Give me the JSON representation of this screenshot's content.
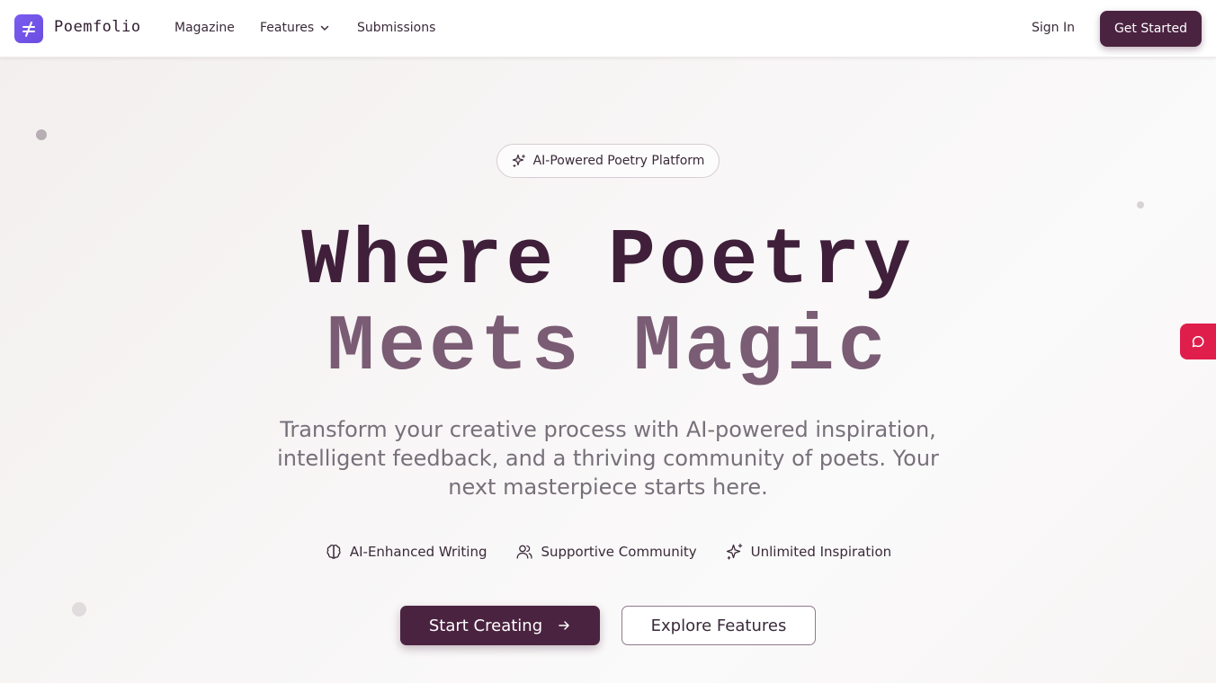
{
  "brand": {
    "name": "Poemfolio",
    "logo_icon": "not-equal-icon",
    "accent": "#6f52e8"
  },
  "nav": {
    "links": [
      {
        "label": "Magazine"
      },
      {
        "label": "Features",
        "has_dropdown": true
      },
      {
        "label": "Submissions"
      }
    ],
    "sign_in": "Sign In",
    "get_started": "Get Started"
  },
  "hero": {
    "badge": "AI-Powered Poetry Platform",
    "headline_line1": "Where Poetry",
    "headline_line2": "Meets Magic",
    "subtitle": "Transform your creative process with AI-powered inspiration, intelligent feedback, and a thriving community of poets. Your next masterpiece starts here.",
    "features": [
      {
        "label": "AI-Enhanced Writing",
        "icon": "brain-icon"
      },
      {
        "label": "Supportive Community",
        "icon": "users-icon"
      },
      {
        "label": "Unlimited Inspiration",
        "icon": "sparkles-icon"
      }
    ],
    "primary_cta": "Start Creating",
    "secondary_cta": "Explore Features"
  },
  "colors": {
    "primary": "#4a2340",
    "headline_dark": "#3f1f3a",
    "headline_light": "#7a5c74",
    "chat_tab": "#e01e4c"
  }
}
